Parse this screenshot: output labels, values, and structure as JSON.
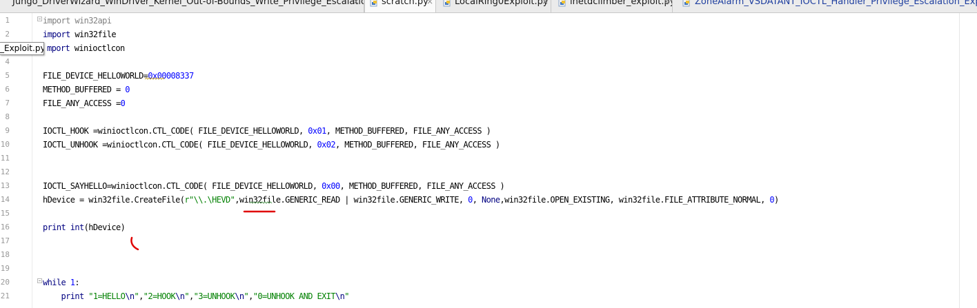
{
  "tabs": [
    {
      "label": "Jungo_DriverWizard_WinDriver_Kernel_Out-of-Bounds_Write_Privilege_Escalation.py",
      "active": false
    },
    {
      "label": "scratch.py",
      "active": true
    },
    {
      "label": "LocalRing0Exploit.py",
      "active": false
    },
    {
      "label": "inetdclimber_exploit.py",
      "active": false
    },
    {
      "label": "ZoneAlarm_VSDATANT_IOCTL_Handler_Privilege_Escalation_Exploit.py",
      "active": false
    }
  ],
  "close_glyph": "×",
  "tooltip": "_Exploit.py",
  "line_numbers": [
    "1",
    "2",
    "3",
    "4",
    "5",
    "6",
    "7",
    "8",
    "9",
    "10",
    "11",
    "12",
    "13",
    "14",
    "15",
    "16",
    "17",
    "18",
    "19",
    "20",
    "21"
  ],
  "code": {
    "l1_kw": "import",
    "l1_rest": " win32api",
    "l2_kw": "import",
    "l2_rest": " win32file",
    "l3_kw": "mport",
    "l3_rest": " winioctlcon",
    "l5_a": "FILE_DEVICE_HELLOWORLD=",
    "l5_num": "0x00008337",
    "l6_a": "METHOD_BUFFERED = ",
    "l6_num": "0",
    "l7_a": "FILE_ANY_ACCESS =",
    "l7_num": "0",
    "l9_a": "IOCTL_HOOK =winioctlcon.CTL_CODE( FILE_DEVICE_HELLOWORLD, ",
    "l9_num": "0x01",
    "l9_b": ", METHOD_BUFFERED, FILE_ANY_ACCESS )",
    "l10_a": "IOCTL_UNHOOK =winioctlcon.CTL_CODE( FILE_DEVICE_HELLOWORLD, ",
    "l10_num": "0x02",
    "l10_b": ", METHOD_BUFFERED, FILE_ANY_ACCESS )",
    "l13_a": "IOCTL_SAYHELLO=winioctlcon.CTL_CODE( FILE_DEVICE_HELLOWORLD, ",
    "l13_num": "0x00",
    "l13_b": ", METHOD_BUFFERED, FILE_ANY_ACCESS )",
    "l14_a": "hDevice = win32file.CreateFile(",
    "l14_str": "r\"\\\\.\\HEVD\"",
    "l14_b": ",win32file.GENERIC_READ | win32file.GENERIC_WRITE, ",
    "l14_n1": "0",
    "l14_c": ", ",
    "l14_none": "None",
    "l14_d": ",win32file.OPEN_EXISTING, win32file.FILE_ATTRIBUTE_NORMAL, ",
    "l14_n2": "0",
    "l14_e": ")",
    "l16_kw": "print",
    "l16_sp": " ",
    "l16_int": "int",
    "l16_rest": "(hDevice)",
    "l20_kw": "while",
    "l20_sp": " ",
    "l20_num": "1",
    "l20_rest": ":",
    "l21_indent": "    ",
    "l21_kw": "print",
    "l21_sp": " ",
    "l21_s1": "\"1=HELLO",
    "l21_e1": "\\n",
    "l21_q1": "\"",
    "l21_c1": ",",
    "l21_s2": "\"2=HOOK",
    "l21_e2": "\\n",
    "l21_q2": "\"",
    "l21_c2": ",",
    "l21_s3": "\"3=UNHOOK",
    "l21_e3": "\\n",
    "l21_q3": "\"",
    "l21_c3": ",",
    "l21_s4": "\"0=UNHOOK AND EXIT",
    "l21_e4": "\\n",
    "l21_q4": "\""
  },
  "colors": {
    "keyword": "#000080",
    "number": "#0000ff",
    "string": "#008000",
    "unused_import": "#808080",
    "annotation": "#e00000"
  },
  "icons": {
    "tab": "python-file-icon"
  }
}
